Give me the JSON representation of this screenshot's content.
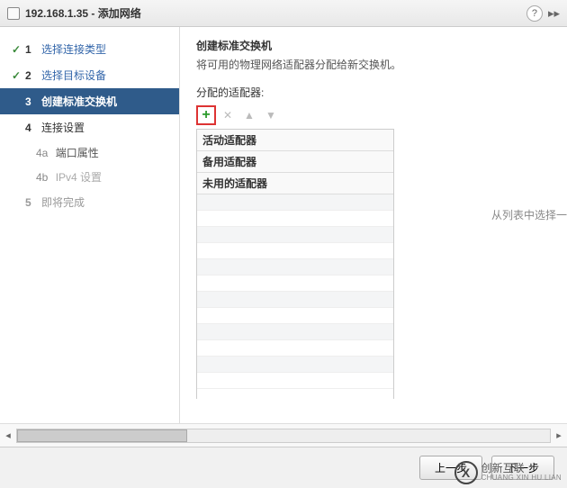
{
  "titlebar": {
    "host": "192.168.1.35",
    "dialog_title": "添加网络",
    "sep": " - "
  },
  "sidebar": {
    "steps": [
      {
        "num": "1",
        "label": "选择连接类型",
        "state": "completed"
      },
      {
        "num": "2",
        "label": "选择目标设备",
        "state": "completed"
      },
      {
        "num": "3",
        "label": "创建标准交换机",
        "state": "current"
      },
      {
        "num": "4",
        "label": "连接设置",
        "state": "pending"
      }
    ],
    "substeps": [
      {
        "num": "4a",
        "label": "端口属性"
      },
      {
        "num": "4b",
        "label": "IPv4 设置"
      }
    ],
    "final": {
      "num": "5",
      "label": "即将完成"
    }
  },
  "content": {
    "heading": "创建标准交换机",
    "sub": "将可用的物理网络适配器分配给新交换机。",
    "section_label": "分配的适配器:",
    "groups": {
      "active": "活动适配器",
      "standby": "备用适配器",
      "unused": "未用的适配器"
    },
    "side_hint": "从列表中选择一"
  },
  "buttons": {
    "back": "上一步",
    "next": "下一步"
  },
  "watermark": {
    "glyph": "X",
    "text": "创新互联",
    "sub": "CHUANG XIN HU LIAN"
  }
}
